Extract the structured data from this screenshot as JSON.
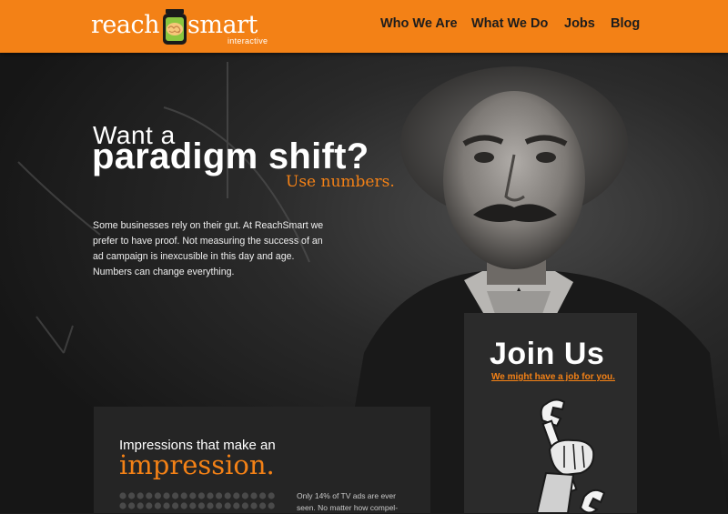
{
  "brand": {
    "logo_left": "reach",
    "logo_right": "smart",
    "logo_sub": "interactive",
    "accent": "#f38116"
  },
  "nav": {
    "items": [
      {
        "label": "Who We Are"
      },
      {
        "label": "What We Do"
      },
      {
        "label": "Jobs"
      },
      {
        "label": "Blog"
      }
    ]
  },
  "hero": {
    "line1": "Want a",
    "line2": "paradigm shift?",
    "line3": "Use numbers.",
    "body": "Some businesses rely on their gut. At ReachSmart we prefer to have proof. Not measuring the success of an ad campaign is inexcusible in this day and age. Numbers can change everything."
  },
  "join": {
    "title": "Join Us",
    "subtitle": "We might have  a job for you.",
    "icon": "wrench-icon"
  },
  "impressions": {
    "line1": "Impressions that make an",
    "line2": "impression.",
    "body": "Only 14% of TV ads are ever seen.  No matter how compel-"
  }
}
